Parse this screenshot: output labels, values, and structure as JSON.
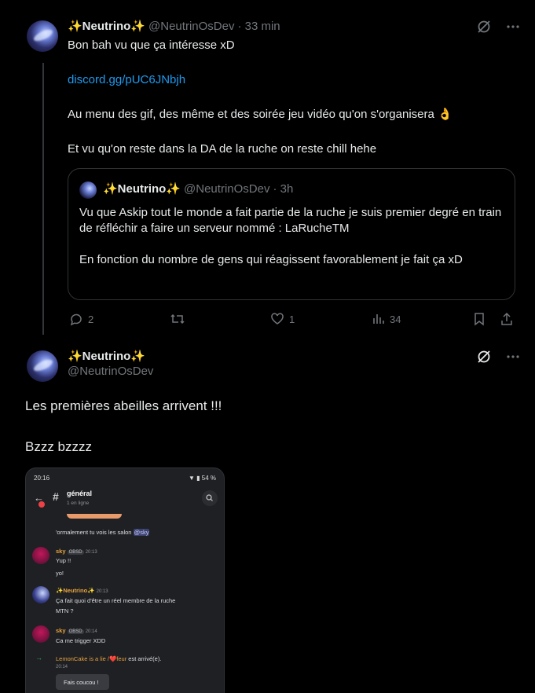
{
  "tweet1": {
    "display_name": "✨Neutrino✨",
    "handle": "@NeutrinOsDev",
    "time": "· 33 min",
    "line1": "Bon bah vu que ça intéresse xD",
    "link": "discord.gg/pUC6JNbjh",
    "line3": "Au menu des gif, des même et des soirée jeu vidéo qu'on s'organisera 👌",
    "line4": "Et vu qu'on reste dans la DA de la ruche on reste chill hehe",
    "quote": {
      "display_name": "✨Neutrino✨",
      "handle": "@NeutrinOsDev",
      "time": "· 3h",
      "para1": "Vu que Askip tout le monde a fait partie de la ruche je suis premier degré en train de réfléchir a faire un serveur nommé : LaRucheTM",
      "para2": "En fonction du nombre de gens qui réagissent favorablement je fait ça xD"
    },
    "actions": {
      "replies": "2",
      "likes": "1",
      "views": "34"
    }
  },
  "tweet2": {
    "display_name": "✨Neutrino✨",
    "handle": "@NeutrinOsDev",
    "line1": "Les premières abeilles arrivent !!!",
    "line2": "Bzzz bzzzz"
  },
  "media": {
    "status_time": "20:16",
    "battery": "54 %",
    "channel": "général",
    "channel_sub": "1 en ligne",
    "m0": "'ormalement tu vois les salon",
    "m0_mention": "@sky",
    "u1": "sky",
    "u1_tag": "OBSD",
    "u1_time": "20:13",
    "u1_l1": "Yup !!",
    "u1_l2": "yo!",
    "u2": "✨Neutrino✨",
    "u2_time": "20:13",
    "u2_l1": "Ça fait quoi d'être un réel membre de la ruche",
    "u2_l2": "MTN ?",
    "u3": "sky",
    "u3_tag": "OBSD",
    "u3_time": "20:14",
    "u3_l1": "Ca me trigger XDD",
    "join_user": "LemonCake is a lie /❤️feur",
    "join_text": " est arrivé(e).",
    "join_time": "20:14",
    "wave_button": "Fais coucou !"
  },
  "colors": {
    "link": "#1d9bf0",
    "muted": "#71767b",
    "border": "#2f3336"
  },
  "icons": [
    "grok-icon",
    "more-icon",
    "reply-icon",
    "retweet-icon",
    "like-icon",
    "views-icon",
    "bookmark-icon",
    "share-icon"
  ]
}
